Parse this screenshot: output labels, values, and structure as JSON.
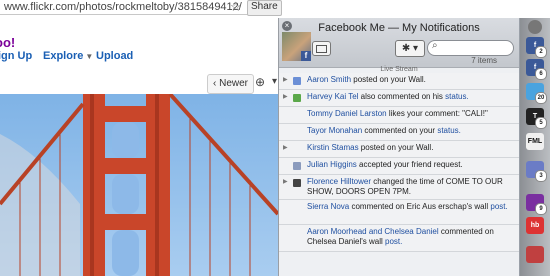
{
  "browser": {
    "url": "www.flickr.com/photos/rockmeltoby/3815849412/",
    "share_label": "Share",
    "yahoo_logo": "oo!",
    "nav": [
      "ign Up",
      "Explore",
      "Upload"
    ],
    "newer_label": "Newer"
  },
  "popup": {
    "title": "Facebook Me — My Notifications",
    "item_count": "7 items",
    "section_label": "Live Stream",
    "search_placeholder": "",
    "notifications": [
      {
        "name": "Aaron Smith",
        "text": " posted on your Wall.",
        "link": "",
        "icon": "wall-post-icon",
        "icon_color": "#6b8fd6"
      },
      {
        "name": "Harvey Kai Tel",
        "text": " also commented on his ",
        "link": "status.",
        "icon": "comment-icon",
        "icon_color": "#5ba84a"
      },
      {
        "name": "Tommy Daniel Larston",
        "text": " likes your comment: \"CALI!\"",
        "link": "",
        "icon": "",
        "icon_color": ""
      },
      {
        "name": "Tayor Monahan",
        "text": " commented on your ",
        "link": "status.",
        "icon": "",
        "icon_color": ""
      },
      {
        "name": "Kirstin Stamas",
        "text": " posted on your Wall.",
        "link": "",
        "icon": "",
        "icon_color": ""
      },
      {
        "name": "Julian Higgins",
        "text": " accepted your friend request.",
        "link": "",
        "icon": "friend-icon",
        "icon_color": "#8b9bbd"
      },
      {
        "name": "Florence Hilltower",
        "text": " changed the time of COME TO OUR SHOW, DOORS OPEN 7PM.",
        "link": "",
        "icon": "event-icon",
        "icon_color": "#444"
      },
      {
        "name": "Sierra Nova",
        "text": " commented on Eric Aus  erschap's wall ",
        "link": "post.",
        "icon": "",
        "icon_color": ""
      },
      {
        "name": "Aaron Moorhead and Chelsea Daniel",
        "text": " commented on Chelsea Daniel's wall ",
        "link": "post.",
        "icon": "",
        "icon_color": ""
      }
    ]
  },
  "dock": [
    {
      "label": "f",
      "badge": "2",
      "color": "#3b5998",
      "icon": "facebook-icon"
    },
    {
      "label": "f",
      "badge": "6",
      "color": "#3b5998",
      "icon": "facebook-icon"
    },
    {
      "label": "",
      "badge": "20",
      "color": "#4aa3df",
      "icon": "twitter-icon"
    },
    {
      "label": "T",
      "badge": "5",
      "color": "#222",
      "icon": "nytimes-icon"
    },
    {
      "label": "FML",
      "badge": "",
      "color": "#f0f0f0",
      "icon": "fml-icon"
    },
    {
      "label": "",
      "badge": "3",
      "color": "#6b7cc6",
      "icon": "app-icon"
    },
    {
      "label": "",
      "badge": "9",
      "color": "#7a2fa0",
      "icon": "app-icon"
    },
    {
      "label": "hb",
      "badge": "",
      "color": "#d33",
      "icon": "hb-icon"
    },
    {
      "label": "",
      "badge": "",
      "color": "#c04040",
      "icon": "app-icon"
    }
  ]
}
